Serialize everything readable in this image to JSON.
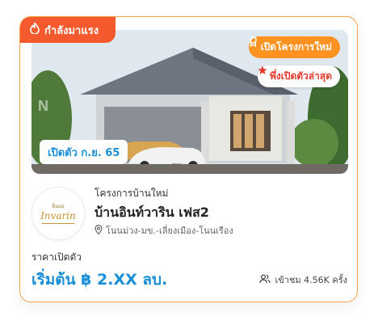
{
  "trending": {
    "label": "กำลังมาแรง",
    "icon": "fire-icon"
  },
  "badges": {
    "new_project": {
      "label": "เปิดโครงการใหม่",
      "icon": "award-icon",
      "color": "#ff9220"
    },
    "just_opened": {
      "label": "พึ่งเปิดตัวล่าสุด",
      "icon": "star-icon",
      "color": "#e63a2e"
    }
  },
  "open_date": "เปิดตัว ก.ย. 65",
  "logo": {
    "top_text": "Baan",
    "main_text": "Invarin"
  },
  "project": {
    "category": "โครงการบ้านใหม่",
    "name": "บ้านอินท์วาริน เฟส2",
    "location": "โนนม่วง-มข.-เลี่ยงเมือง-โนนเรือง"
  },
  "price": {
    "label": "ราคาเปิดตัว",
    "value": "เริ่มต้น ฿ 2.XX ลบ."
  },
  "views": {
    "label": "เข้าชม 4.56K ครั้ง",
    "icon": "users-icon"
  },
  "colors": {
    "accent_blue": "#1a8fd6",
    "trend_orange": "#f45a2e",
    "border": "#f6a04a"
  }
}
